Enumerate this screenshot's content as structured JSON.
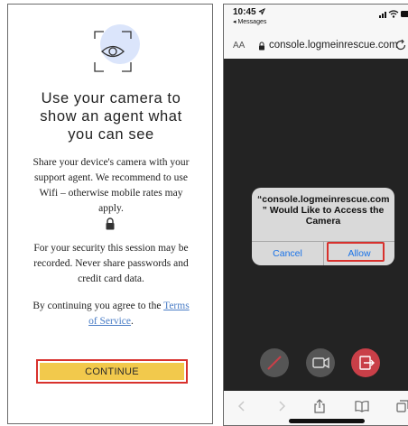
{
  "left": {
    "headline": [
      "Use your camera to",
      "show an agent what",
      "you can see"
    ],
    "paragraph1": [
      "Share your device's camera with your",
      "support agent. We recommend to use",
      "Wifi – otherwise mobile rates may",
      "apply."
    ],
    "paragraph2": [
      "For your security this session may be",
      "recorded. Never share passwords and",
      "credit card data."
    ],
    "agree_prefix": "By continuing you agree to the ",
    "terms_part1": "Terms",
    "terms_part2": "of Service",
    "agree_suffix": ".",
    "continue_label": "CONTINUE",
    "colors": {
      "button": "#f2c94c",
      "highlight": "#d8312d",
      "link": "#4a7dc6"
    }
  },
  "right": {
    "status": {
      "time": "10:45",
      "back_label": "◂ Messages"
    },
    "address": {
      "aa": "AA",
      "url": "console.logmeinrescue.com"
    },
    "dialog": {
      "title": [
        "“console.logmeinrescue.com",
        "” Would Like to Access the",
        "Camera"
      ],
      "cancel_label": "Cancel",
      "allow_label": "Allow"
    },
    "controls": [
      "pen-off-icon",
      "video-camera-icon",
      "exit-session-icon"
    ],
    "nav_icons": [
      "back-icon",
      "forward-icon",
      "share-icon",
      "bookmarks-icon",
      "tabs-icon"
    ],
    "colors": {
      "dialog_button": "#1a73e8",
      "exit": "#c93f48"
    }
  }
}
